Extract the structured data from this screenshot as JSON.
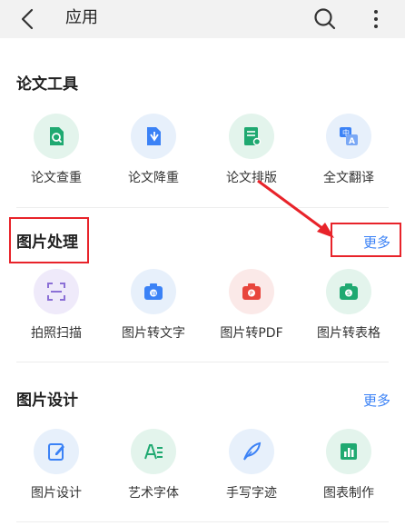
{
  "header": {
    "title": "应用"
  },
  "sections": [
    {
      "title": "论文工具",
      "items": [
        "论文查重",
        "论文降重",
        "论文排版",
        "全文翻译"
      ]
    },
    {
      "title": "图片处理",
      "more": "更多",
      "items": [
        "拍照扫描",
        "图片转文字",
        "图片转PDF",
        "图片转表格"
      ]
    },
    {
      "title": "图片设计",
      "more": "更多",
      "items": [
        "图片设计",
        "艺术字体",
        "手写字迹",
        "图表制作"
      ]
    }
  ],
  "colors": {
    "accent": "#3b82f6",
    "green": "#1fa971",
    "annotation": "#e8232a"
  }
}
